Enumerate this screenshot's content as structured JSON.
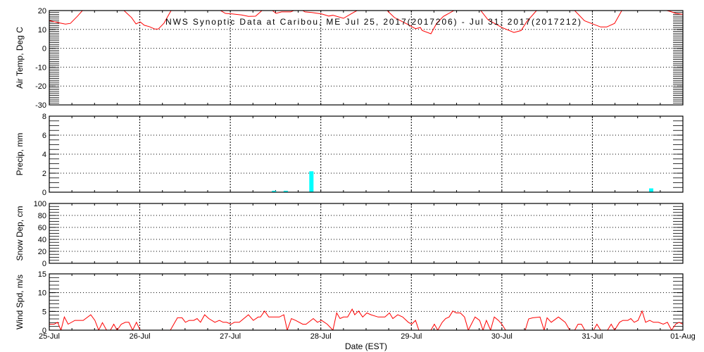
{
  "chart_data": [
    {
      "type": "line",
      "title": "NWS Synoptic Data at Caribou, ME   Jul 25, 2017(2017206) - Jul 31, 2017(2017212)",
      "ylabel": "Air Temp, Deg C",
      "ylim": [
        -30,
        20
      ],
      "yticks": [
        "-30",
        "-20",
        "-10",
        "0",
        "10",
        "20"
      ],
      "grid": true,
      "color": "#ff0000",
      "x_unit": "hours since 25-Jul 00:00 EST",
      "points": [
        [
          0,
          14.7
        ],
        [
          2.4,
          13.6
        ],
        [
          4.3,
          12.8
        ],
        [
          5.6,
          13.2
        ],
        [
          7.5,
          17.1
        ],
        [
          8.8,
          20
        ],
        [
          14.2,
          25
        ],
        [
          19.8,
          20
        ],
        [
          21.8,
          16.3
        ],
        [
          23,
          12.9
        ],
        [
          24.1,
          14
        ],
        [
          25.2,
          12.2
        ],
        [
          26.5,
          11.5
        ],
        [
          28,
          10.2
        ],
        [
          28.9,
          10.2
        ],
        [
          30.4,
          13.3
        ],
        [
          32.3,
          20
        ],
        [
          38.8,
          25
        ],
        [
          45.4,
          20
        ],
        [
          46.7,
          18.5
        ],
        [
          48.5,
          18.2
        ],
        [
          51,
          17.7
        ],
        [
          52.8,
          16.9
        ],
        [
          54.7,
          17
        ],
        [
          56.4,
          20
        ],
        [
          57.9,
          22
        ],
        [
          59.2,
          20
        ],
        [
          60.1,
          18.5
        ],
        [
          61.6,
          19.3
        ],
        [
          64,
          19.3
        ],
        [
          64.8,
          20
        ],
        [
          65.9,
          21
        ],
        [
          67.2,
          20
        ],
        [
          67.8,
          19.3
        ],
        [
          69.6,
          19
        ],
        [
          72.2,
          18.2
        ],
        [
          74.1,
          17.1
        ],
        [
          75.2,
          17.5
        ],
        [
          78,
          15.9
        ],
        [
          80.3,
          18.6
        ],
        [
          81.6,
          20
        ],
        [
          85.5,
          24
        ],
        [
          89.6,
          20
        ],
        [
          91.5,
          16.3
        ],
        [
          95.2,
          12.5
        ],
        [
          97.1,
          10.4
        ],
        [
          98.4,
          11
        ],
        [
          98.9,
          9.4
        ],
        [
          101.2,
          7.7
        ],
        [
          102.7,
          13.2
        ],
        [
          104.5,
          16.9
        ],
        [
          107.3,
          20
        ],
        [
          110.9,
          24
        ],
        [
          114.4,
          20
        ],
        [
          116.3,
          15.2
        ],
        [
          120,
          11
        ],
        [
          123.2,
          8.4
        ],
        [
          125.1,
          9.4
        ],
        [
          126.6,
          14.1
        ],
        [
          129.2,
          20
        ],
        [
          134.4,
          25
        ],
        [
          139.3,
          20
        ],
        [
          141.9,
          14.6
        ],
        [
          143.7,
          13.2
        ],
        [
          146.2,
          11.3
        ],
        [
          147.8,
          11.3
        ],
        [
          149.9,
          13.2
        ],
        [
          151.8,
          20
        ],
        [
          157.7,
          25
        ],
        [
          163.7,
          20
        ],
        [
          164.6,
          19.6
        ],
        [
          166.1,
          18.5
        ],
        [
          168,
          18
        ]
      ]
    },
    {
      "type": "bar",
      "ylabel": "Precip, mm",
      "ylim": [
        0,
        8
      ],
      "yticks": [
        "0",
        "2",
        "4",
        "6",
        "8"
      ],
      "grid": true,
      "color": "#00ffff",
      "x_unit": "hours since 25-Jul 00:00 EST",
      "bars": [
        [
          59.6,
          0.15
        ],
        [
          62.7,
          0.15
        ],
        [
          69.5,
          2.2
        ],
        [
          159.6,
          0.4
        ]
      ]
    },
    {
      "type": "line",
      "ylabel": "Snow Dep, cm",
      "ylim": [
        0,
        100
      ],
      "yticks": [
        "0",
        "20",
        "40",
        "60",
        "80",
        "100"
      ],
      "grid": true,
      "points": []
    },
    {
      "type": "line",
      "ylabel": "Wind Spd, m/s",
      "ylim": [
        0,
        15
      ],
      "yticks": [
        "0",
        "5",
        "10",
        "15"
      ],
      "grid": true,
      "color": "#ff0000",
      "x_unit": "hours since 25-Jul 00:00 EST",
      "xlabel": "Date (EST)",
      "xticks": [
        "25-Jul",
        "26-Jul",
        "27-Jul",
        "28-Jul",
        "29-Jul",
        "30-Jul",
        "31-Jul",
        "01-Aug"
      ],
      "xlim_hours": [
        0,
        168
      ],
      "points": [
        [
          0,
          1.6
        ],
        [
          1.3,
          1.6
        ],
        [
          2.2,
          2.1
        ],
        [
          3.1,
          0
        ],
        [
          4,
          3.5
        ],
        [
          5,
          1.6
        ],
        [
          6.8,
          2.6
        ],
        [
          9,
          2.6
        ],
        [
          11,
          4.1
        ],
        [
          12.1,
          2.6
        ],
        [
          13.1,
          0
        ],
        [
          14.1,
          2
        ],
        [
          15.2,
          0
        ],
        [
          16.2,
          0
        ],
        [
          17.1,
          1.6
        ],
        [
          18,
          0
        ],
        [
          19.1,
          1.6
        ],
        [
          20.2,
          2.1
        ],
        [
          21.1,
          2.1
        ],
        [
          22.1,
          0
        ],
        [
          23.1,
          2.1
        ],
        [
          24.1,
          0
        ],
        [
          32.1,
          0
        ],
        [
          34,
          3.3
        ],
        [
          35.2,
          3.3
        ],
        [
          36.1,
          2.1
        ],
        [
          37.1,
          2.6
        ],
        [
          38.3,
          2.6
        ],
        [
          39.2,
          3.1
        ],
        [
          40.1,
          2.1
        ],
        [
          41.2,
          4.1
        ],
        [
          42.3,
          3.1
        ],
        [
          43.9,
          2.1
        ],
        [
          45.1,
          2.6
        ],
        [
          46.1,
          2.1
        ],
        [
          47,
          2.1
        ],
        [
          48.2,
          1.6
        ],
        [
          49.1,
          2.1
        ],
        [
          50.4,
          2.1
        ],
        [
          52.8,
          4.1
        ],
        [
          54.1,
          2.6
        ],
        [
          55.4,
          3.5
        ],
        [
          56,
          3.5
        ],
        [
          57.1,
          5.1
        ],
        [
          58.2,
          3.5
        ],
        [
          61,
          3.5
        ],
        [
          62.2,
          4.1
        ],
        [
          63.1,
          0
        ],
        [
          64.2,
          3.1
        ],
        [
          65.3,
          2.6
        ],
        [
          67.2,
          1.6
        ],
        [
          68.1,
          1.6
        ],
        [
          70,
          3.1
        ],
        [
          71.1,
          2.1
        ],
        [
          72.2,
          2.6
        ],
        [
          73.7,
          1.6
        ],
        [
          75.2,
          0
        ],
        [
          76.2,
          4.6
        ],
        [
          77.1,
          3.1
        ],
        [
          78,
          3.5
        ],
        [
          79.1,
          3.5
        ],
        [
          80.3,
          5.6
        ],
        [
          81,
          4.1
        ],
        [
          82,
          5.1
        ],
        [
          83.1,
          3.5
        ],
        [
          84.2,
          4.6
        ],
        [
          85.3,
          4.1
        ],
        [
          87.2,
          3.5
        ],
        [
          89,
          3.5
        ],
        [
          90.2,
          4.6
        ],
        [
          91.1,
          3.1
        ],
        [
          92.4,
          4.1
        ],
        [
          93.7,
          3.5
        ],
        [
          95.2,
          2.1
        ],
        [
          96.1,
          1.6
        ],
        [
          97.1,
          2.6
        ],
        [
          98,
          0
        ],
        [
          101.2,
          0
        ],
        [
          102.1,
          1.6
        ],
        [
          103,
          0
        ],
        [
          104.2,
          2.1
        ],
        [
          105.1,
          3.1
        ],
        [
          106,
          3.5
        ],
        [
          107,
          5.1
        ],
        [
          107.9,
          4.6
        ],
        [
          109,
          4.6
        ],
        [
          110.1,
          3.5
        ],
        [
          111.1,
          0
        ],
        [
          112.9,
          3.5
        ],
        [
          114.1,
          2.6
        ],
        [
          115,
          0
        ],
        [
          115.9,
          2.6
        ],
        [
          117,
          0
        ],
        [
          118,
          3.5
        ],
        [
          119.1,
          2.6
        ],
        [
          120,
          1.6
        ],
        [
          121,
          0
        ],
        [
          126.2,
          0
        ],
        [
          127.1,
          3
        ],
        [
          128.2,
          3.3
        ],
        [
          130.1,
          3.5
        ],
        [
          131.2,
          0
        ],
        [
          132,
          3.3
        ],
        [
          133.1,
          2.1
        ],
        [
          135,
          3.5
        ],
        [
          136.8,
          2.1
        ],
        [
          138,
          0
        ],
        [
          139.3,
          0
        ],
        [
          140.2,
          1.6
        ],
        [
          141.1,
          1.6
        ],
        [
          142,
          0
        ],
        [
          144.3,
          0
        ],
        [
          145.2,
          1.6
        ],
        [
          146.2,
          0
        ],
        [
          148,
          0
        ],
        [
          149,
          1.6
        ],
        [
          149.9,
          0
        ],
        [
          151.2,
          2.1
        ],
        [
          152.1,
          2.6
        ],
        [
          153.4,
          2.6
        ],
        [
          154.2,
          3.1
        ],
        [
          155.1,
          2.1
        ],
        [
          156.1,
          2.6
        ],
        [
          157.2,
          5.1
        ],
        [
          158.1,
          2.1
        ],
        [
          159.2,
          2.6
        ],
        [
          160.2,
          2.1
        ],
        [
          161.5,
          2.1
        ],
        [
          162.8,
          1.6
        ],
        [
          163.9,
          2.1
        ],
        [
          165,
          0
        ],
        [
          166.1,
          1.6
        ],
        [
          167,
          2.1
        ],
        [
          168,
          1.6
        ]
      ]
    }
  ]
}
